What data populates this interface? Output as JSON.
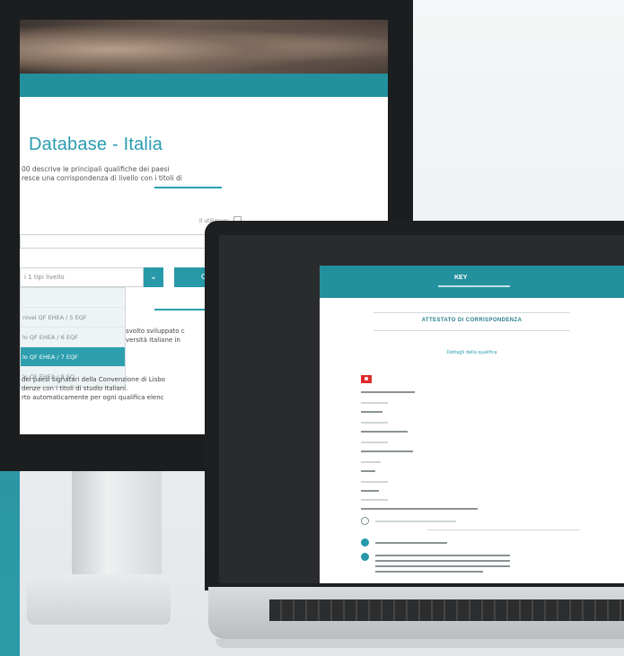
{
  "desktop": {
    "page_title": "Database - Italia",
    "intro_text": "00 descrive le principali qualifiche dei paesi\nresce una corrispondenza di livello con i titoli di",
    "filter_label": "Il utilizzare",
    "select_placeholder": "i 1 tipi livello",
    "search_button": "Cerca",
    "dropdown_items": [
      "",
      "nivel QF EHEA / 5 EQF",
      "lo QF EHEA / 6 EQF",
      "lo QF EHEA / 7 EQF",
      "lo QF EHEA / 8 EQ"
    ],
    "dropdown_active_index": 3,
    "para1": "svolto sviluppato c\nversità Italiane in",
    "para2": "dei paesi signatari della Convenzione di Lisbo\ndenze con i titoli di studio italiani.\nrto automaticamente per ogni qualifica elenc"
  },
  "laptop": {
    "doc_logo": "KEY",
    "doc_title": "ATTESTATO DI CORRISPONDENZA",
    "doc_section": "Dettagli della qualifica"
  },
  "colors": {
    "accent_teal": "#23909e",
    "title_teal": "#2a9cb0",
    "flag_red": "#e02c2c"
  }
}
